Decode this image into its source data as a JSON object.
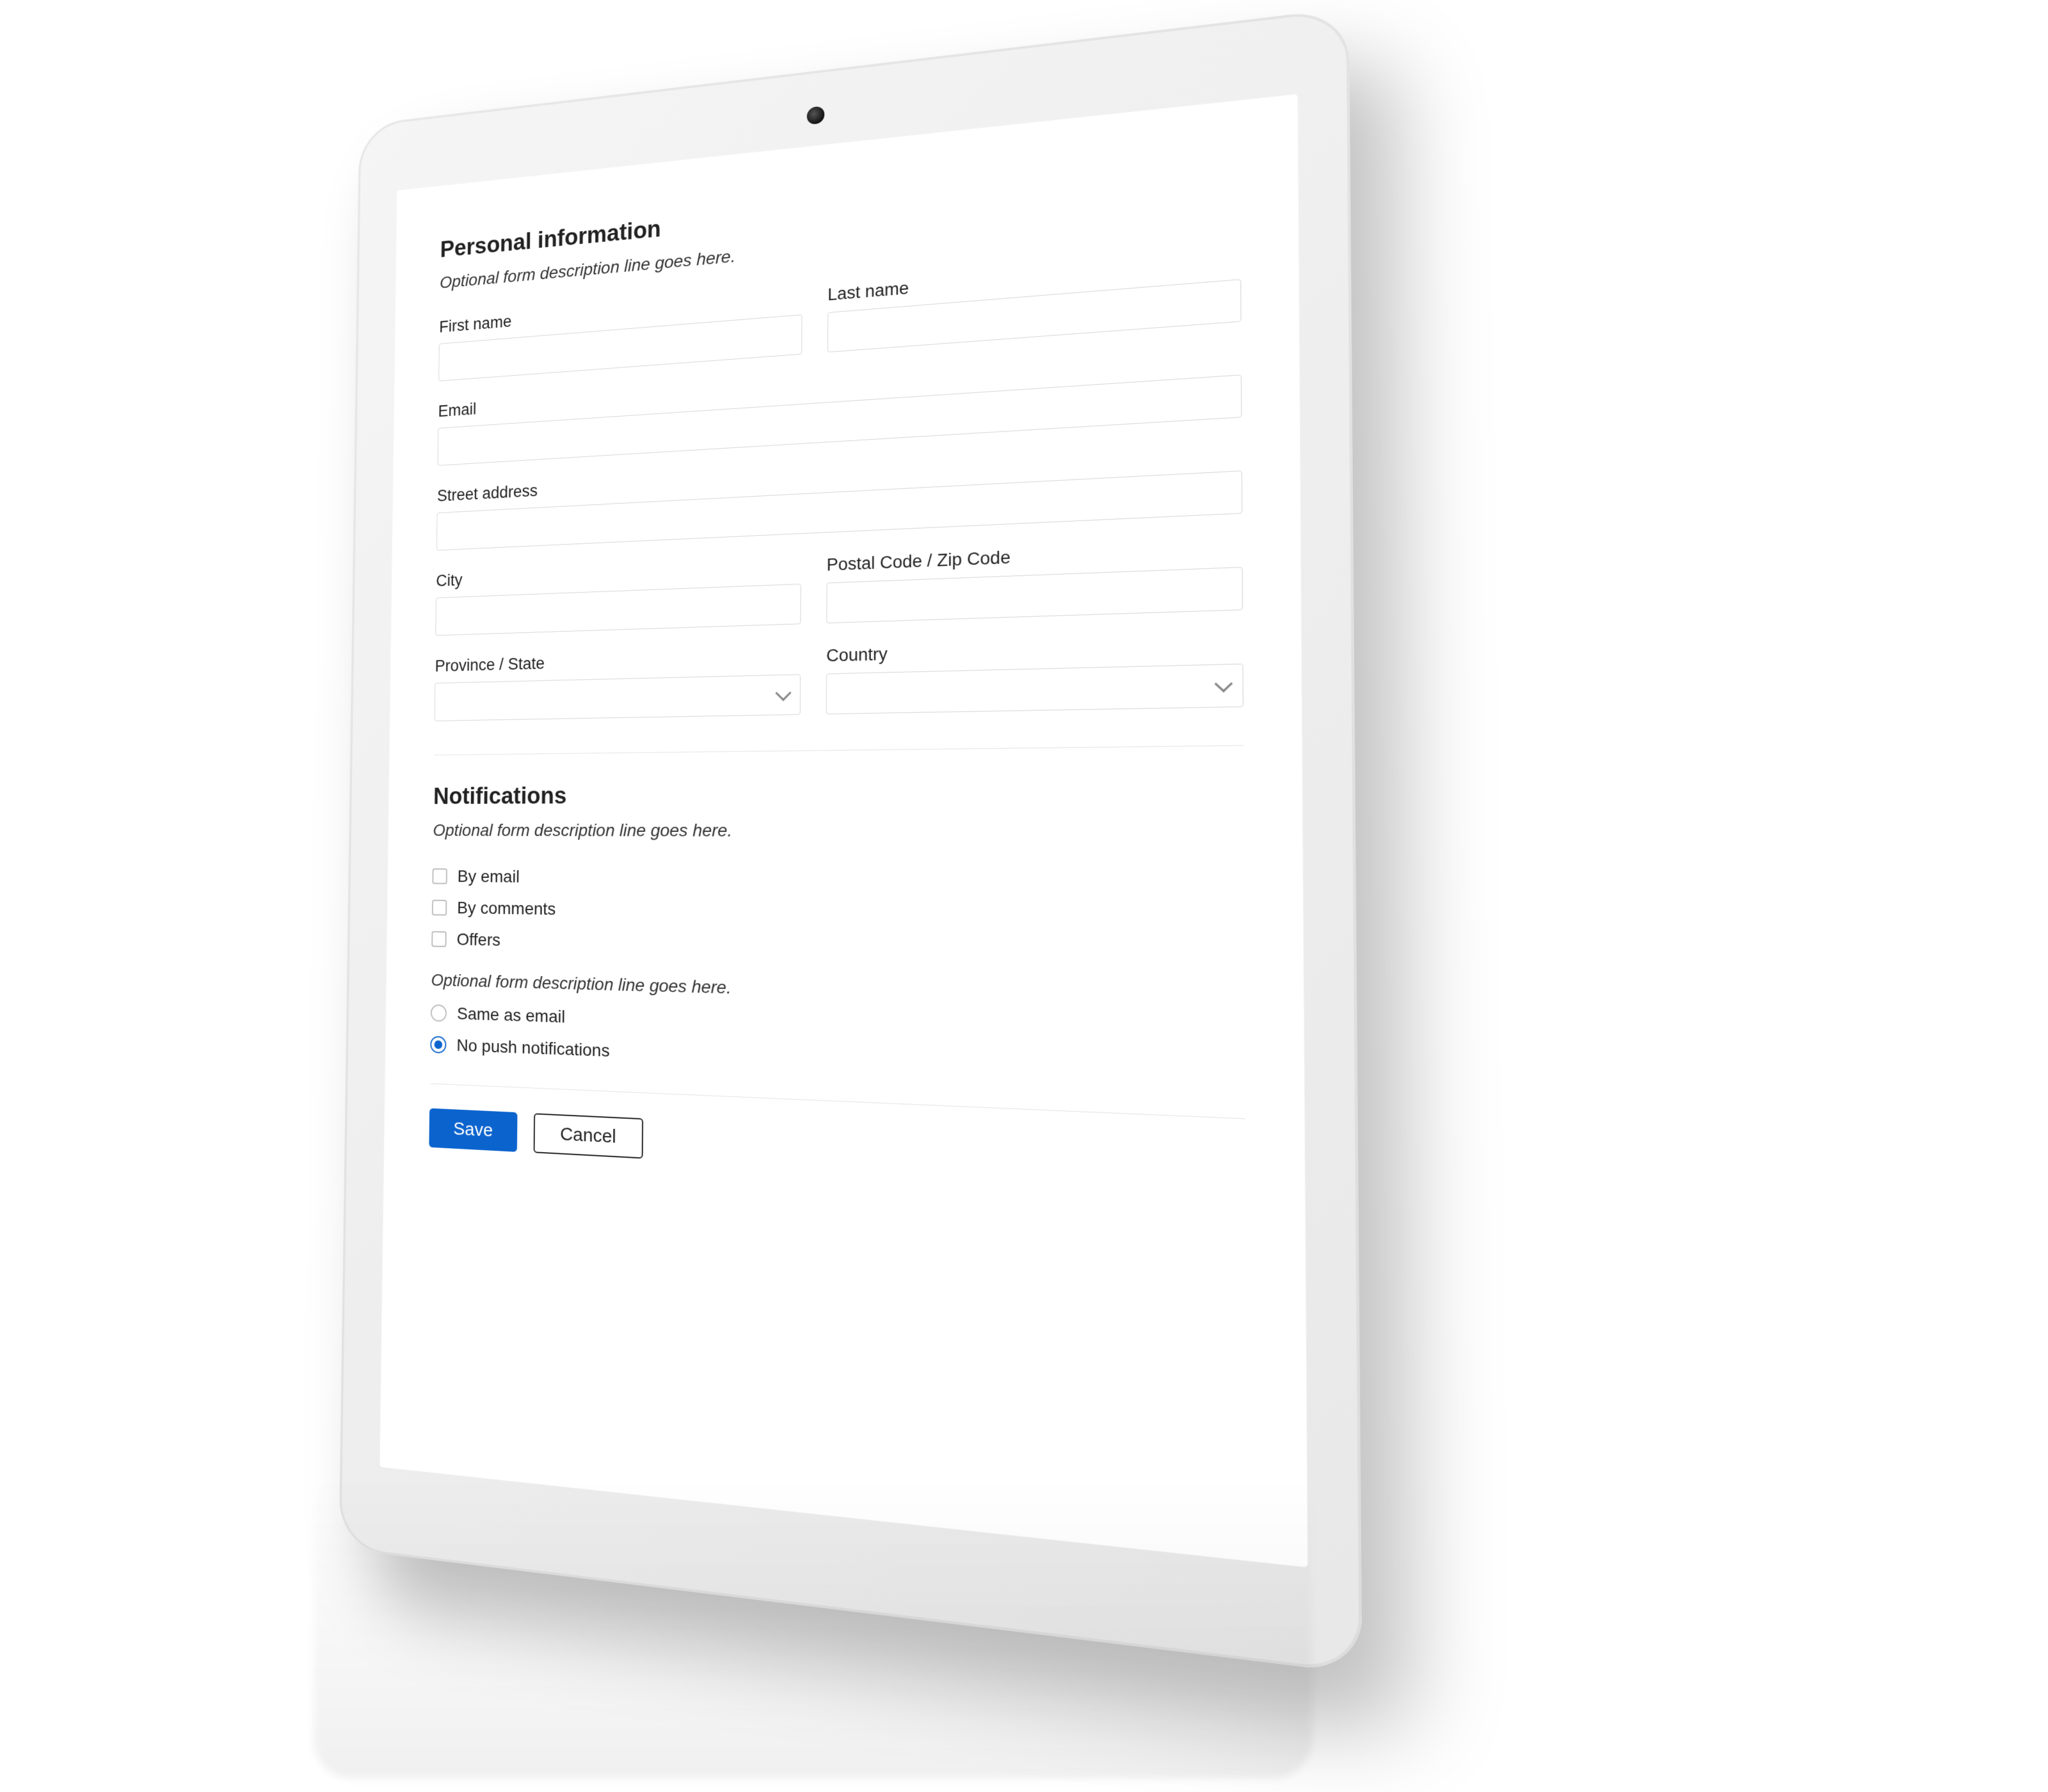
{
  "sections": {
    "personal": {
      "title": "Personal information",
      "description": "Optional form description line goes here.",
      "fields": {
        "first_name": {
          "label": "First name",
          "value": ""
        },
        "last_name": {
          "label": "Last name",
          "value": ""
        },
        "email": {
          "label": "Email",
          "value": ""
        },
        "street_address": {
          "label": "Street address",
          "value": ""
        },
        "city": {
          "label": "City",
          "value": ""
        },
        "postal_code": {
          "label": "Postal Code / Zip Code",
          "value": ""
        },
        "province_state": {
          "label": "Province / State",
          "value": ""
        },
        "country": {
          "label": "Country",
          "value": ""
        }
      }
    },
    "notifications": {
      "title": "Notifications",
      "description": "Optional form description line goes here.",
      "checkboxes": [
        {
          "label": "By email",
          "checked": false
        },
        {
          "label": "By comments",
          "checked": false
        },
        {
          "label": "Offers",
          "checked": false
        }
      ],
      "radio_description": "Optional form description line goes here.",
      "radios": [
        {
          "label": "Same as email",
          "selected": false
        },
        {
          "label": "No push notifications",
          "selected": true
        }
      ]
    }
  },
  "buttons": {
    "save": "Save",
    "cancel": "Cancel"
  },
  "colors": {
    "primary": "#0b63ce",
    "border": "#d6d6d6"
  }
}
